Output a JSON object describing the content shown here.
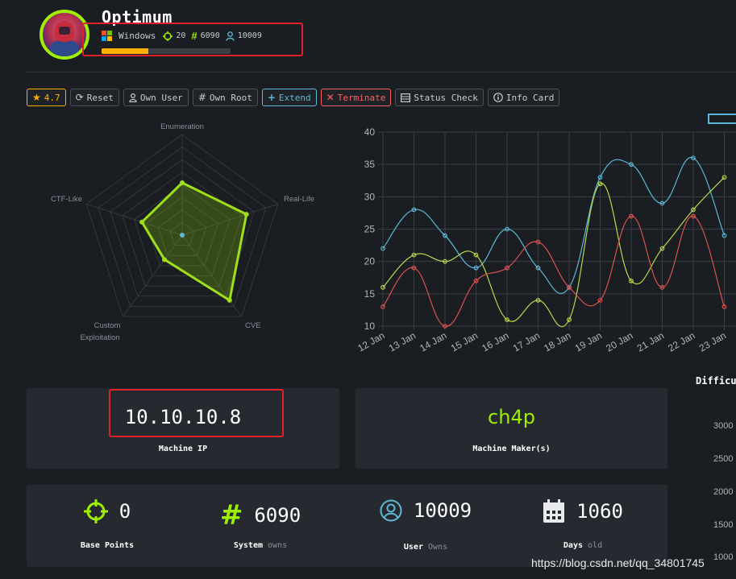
{
  "machine": {
    "name": "Optimum",
    "os": "Windows",
    "points": "20",
    "system_owns": "6090",
    "user_owns": "10009",
    "progress_fraction": 0.36
  },
  "colors": {
    "accent_green": "#9fef00",
    "accent_blue": "#5cb8d6",
    "accent_red": "#ff5f5f",
    "accent_yellow": "#ffaf00",
    "annotation_red": "#e0212c"
  },
  "toolbar": {
    "rating": "4.7",
    "reset": "Reset",
    "own_user": "Own User",
    "own_root": "Own Root",
    "extend": "Extend",
    "terminate": "Terminate",
    "status_check": "Status Check",
    "info_card": "Info Card"
  },
  "radar": {
    "labels": [
      "Enumeration",
      "Real-Life",
      "CVE",
      "Custom",
      "Exploitation",
      "CTF-Like"
    ],
    "axes": [
      "Enumeration",
      "Real-Life",
      "CVE",
      "Custom Exploitation",
      "CTF-Like"
    ],
    "values": [
      0.52,
      0.67,
      0.8,
      0.3,
      0.42
    ],
    "max": 1
  },
  "chart_data": [
    {
      "type": "line",
      "categories": [
        "12 Jan",
        "13 Jan",
        "14 Jan",
        "15 Jan",
        "16 Jan",
        "17 Jan",
        "18 Jan",
        "19 Jan",
        "20 Jan",
        "21 Jan",
        "22 Jan",
        "23 Jan"
      ],
      "yticks": [
        "10",
        "15",
        "20",
        "25",
        "30",
        "35",
        "40"
      ],
      "ylim": [
        10,
        40
      ],
      "grid": true,
      "series": [
        {
          "color": "#5cb8d6",
          "values": [
            22,
            28,
            24,
            19,
            25,
            19,
            16,
            33,
            35,
            29,
            36,
            24
          ]
        },
        {
          "color": "#b6d94a",
          "values": [
            16,
            21,
            20,
            21,
            11,
            14,
            11,
            32,
            17,
            22,
            28,
            33
          ]
        },
        {
          "color": "#d9534f",
          "values": [
            13,
            19,
            10,
            17,
            19,
            23,
            16,
            14,
            27,
            16,
            27,
            13
          ]
        }
      ]
    }
  ],
  "cards": {
    "ip": {
      "value": "10.10.10.8",
      "caption": "Machine IP"
    },
    "maker": {
      "value": "ch4p",
      "caption": "Machine Maker(s)"
    }
  },
  "stats": [
    {
      "icon": "crosshair-icon",
      "value": "0",
      "label": "Base Points",
      "suffix": ""
    },
    {
      "icon": "hash-icon",
      "value": "6090",
      "label": "System",
      "suffix": "owns"
    },
    {
      "icon": "user-icon",
      "value": "10009",
      "label": "User",
      "suffix": "Owns"
    },
    {
      "icon": "calendar-icon",
      "value": "1060",
      "label": "Days",
      "suffix": "old"
    }
  ],
  "difficulty": {
    "title": "Difficu",
    "ticks": [
      "3000",
      "2500",
      "2000",
      "1500",
      "1000"
    ]
  },
  "watermark": "https://blog.csdn.net/qq_34801745"
}
